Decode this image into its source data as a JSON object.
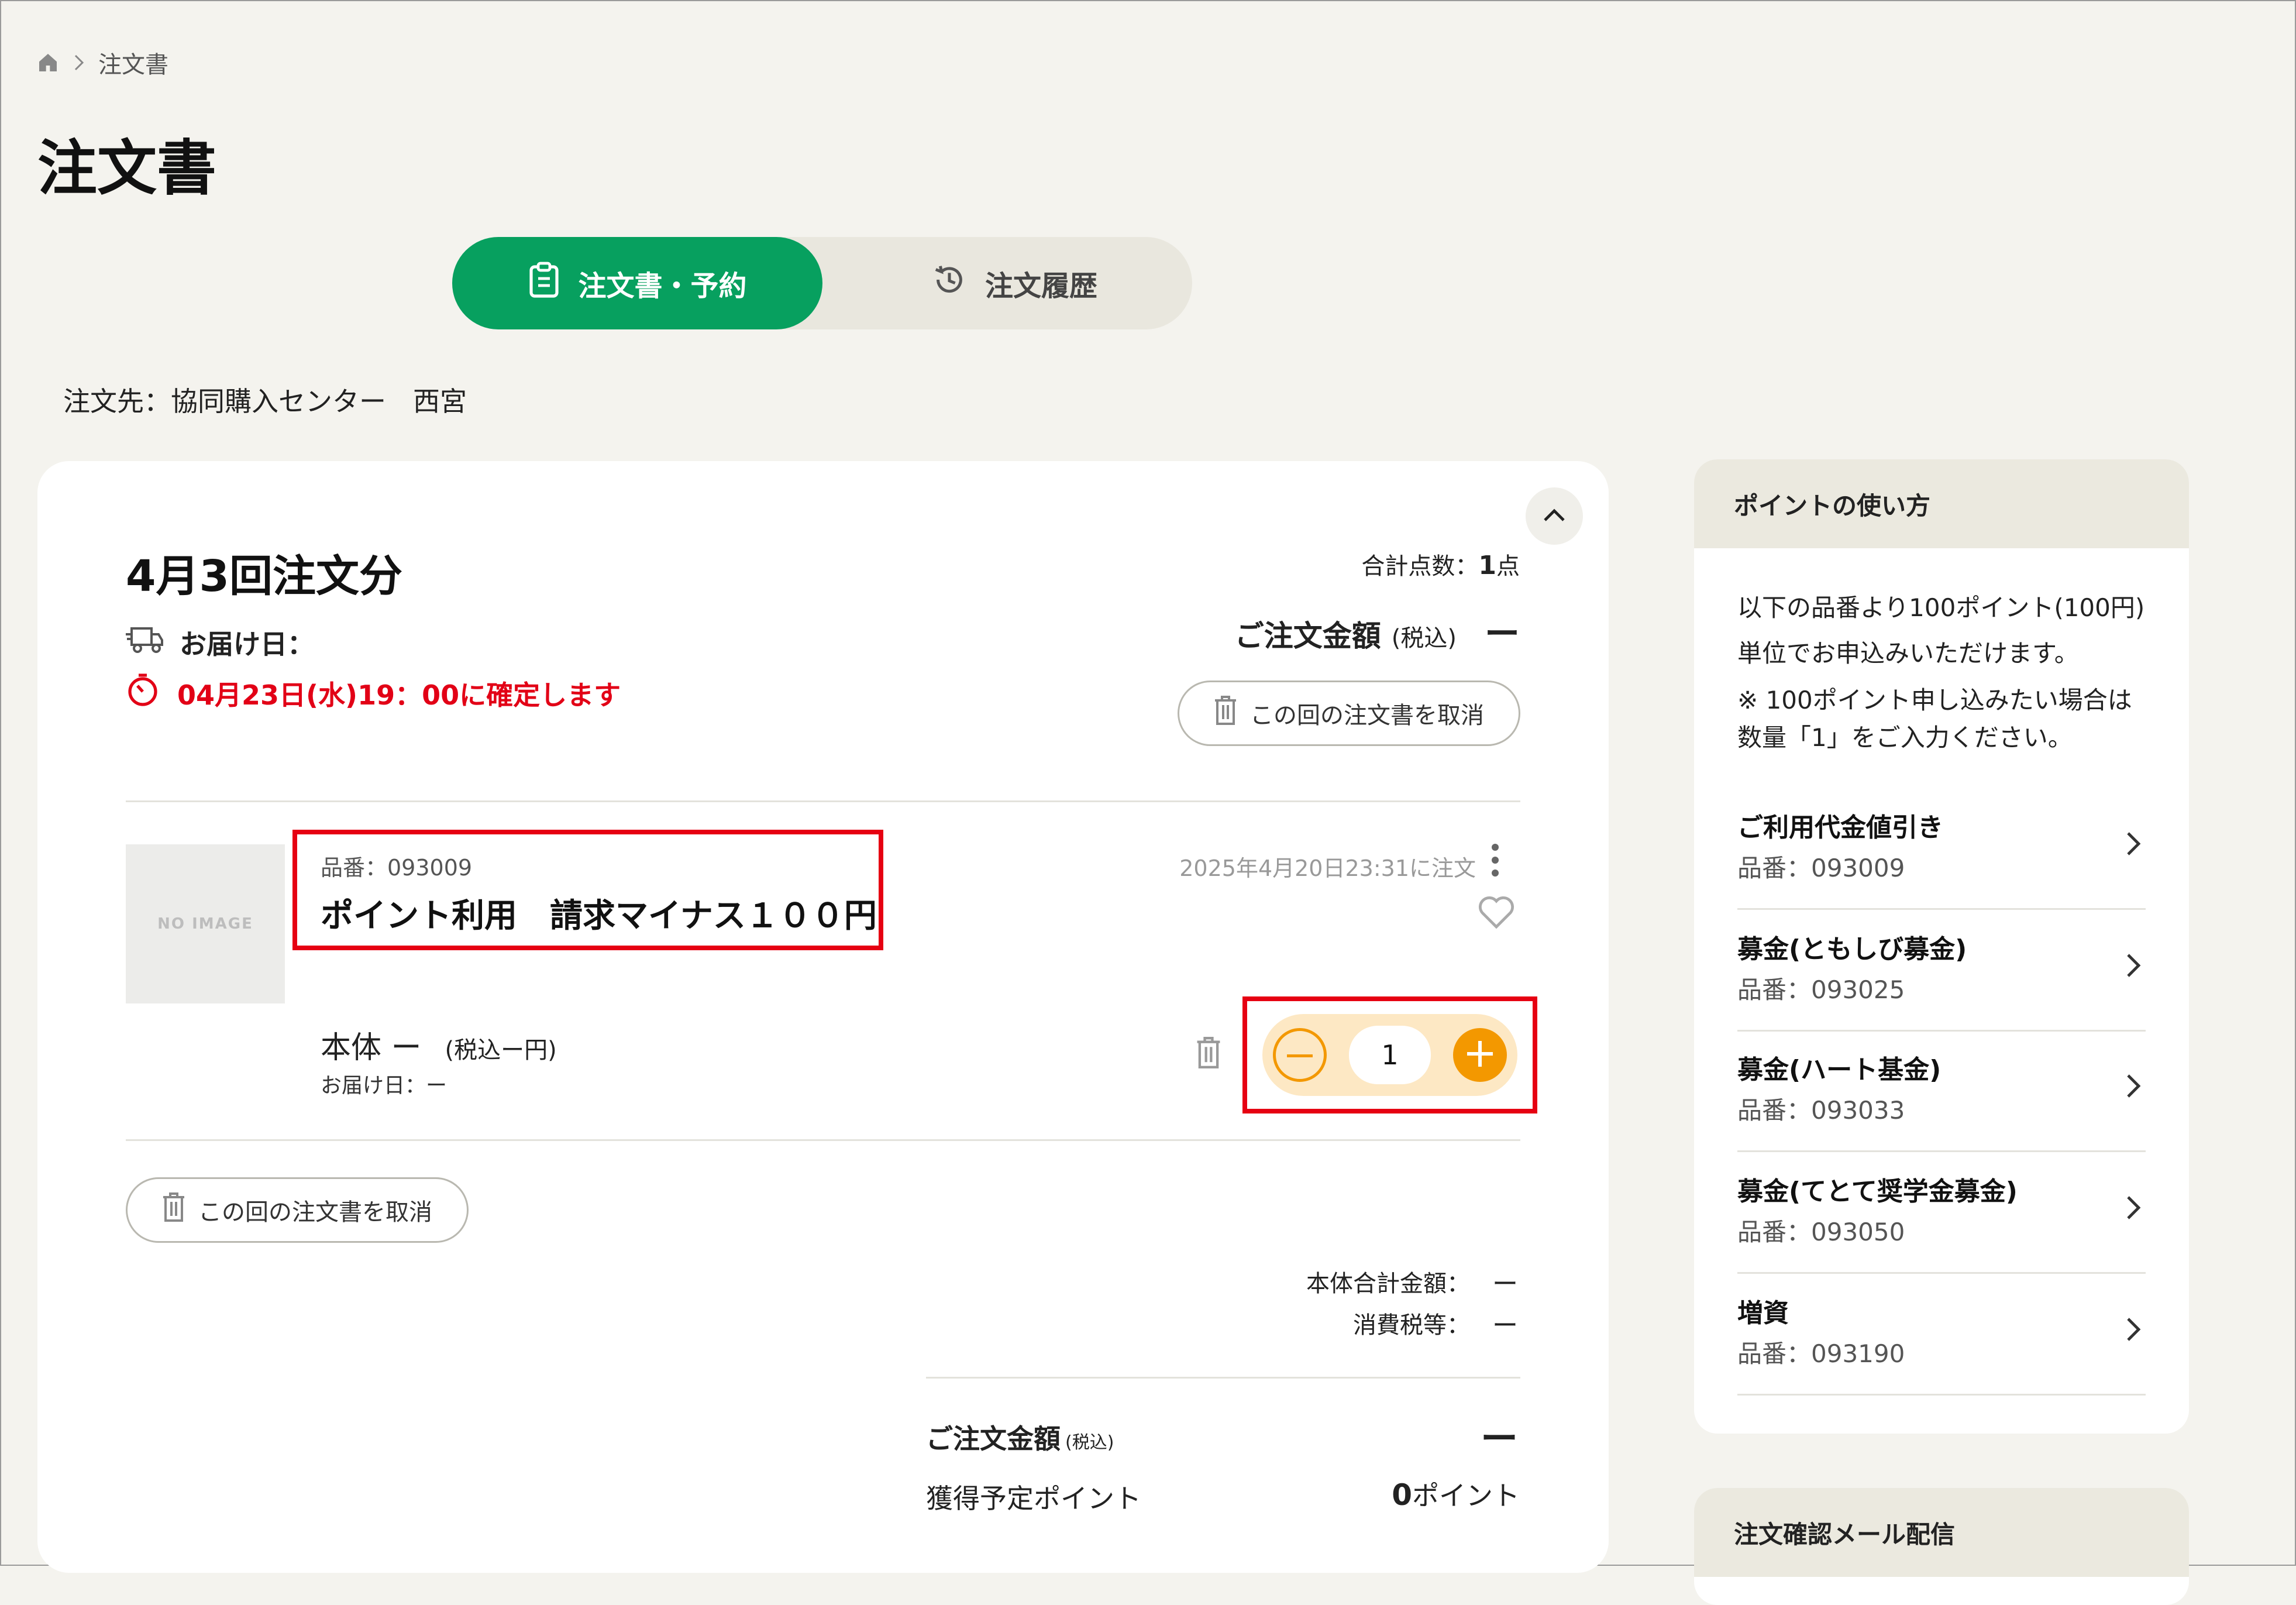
{
  "breadcrumb": {
    "current": "注文書"
  },
  "page_title": "注文書",
  "tabs": [
    {
      "label": "注文書・予約",
      "active": true
    },
    {
      "label": "注文履歴",
      "active": false
    }
  ],
  "order_destination": "注文先：協同購入センター　西宮",
  "order": {
    "round_title": "4月3回注文分",
    "delivery_label": "お届け日：",
    "deadline_text": "04月23日(水)19：00に確定します",
    "total_count_label": "合計点数：",
    "total_count_value": "1",
    "total_count_unit": "点",
    "amount_label": "ご注文金額",
    "amount_tax_note": "(税込)",
    "amount_value": "ー",
    "cancel_label": "この回の注文書を取消",
    "item": {
      "image_label": "NO IMAGE",
      "code": "品番：093009",
      "name": "ポイント利用　請求マイナス１００円",
      "ordered_at": "2025年4月20日23:31に注文",
      "price_main": "本体 ー",
      "price_tax": "(税込ー円)",
      "delivery": "お届け日：ー",
      "quantity": "1"
    },
    "summary": {
      "base_label": "本体合計金額：",
      "base_value": "ー",
      "tax_label": "消費税等：",
      "tax_value": "ー",
      "final_label": "ご注文金額",
      "final_tax_note": "(税込)",
      "final_value": "ー",
      "points_label": "獲得予定ポイント",
      "points_value": "0",
      "points_unit": "ポイント"
    }
  },
  "sidebar": {
    "points_title": "ポイントの使い方",
    "description": "以下の品番より100ポイント(100円)単位でお申込みいただけます。",
    "note": "※ 100ポイント申し込みたい場合は数量「1」をご入力ください。",
    "items": [
      {
        "name": "ご利用代金値引き",
        "code": "品番：093009"
      },
      {
        "name": "募金(ともしび募金)",
        "code": "品番：093025"
      },
      {
        "name": "募金(ハート基金)",
        "code": "品番：093033"
      },
      {
        "name": "募金(てとて奨学金募金)",
        "code": "品番：093050"
      },
      {
        "name": "増資",
        "code": "品番：093190"
      }
    ],
    "mail_title": "注文確認メール配信"
  },
  "colors": {
    "accent_green": "#07a05f",
    "alert_red": "#e20016",
    "highlight_red": "#e60012",
    "stepper_orange": "#f39800"
  },
  "icons": [
    "home-icon",
    "chevron-right-icon",
    "clipboard-icon",
    "history-icon",
    "chevron-up-icon",
    "truck-icon",
    "timer-icon",
    "trash-icon",
    "more-vertical-icon",
    "heart-icon",
    "minus-icon",
    "plus-icon"
  ]
}
